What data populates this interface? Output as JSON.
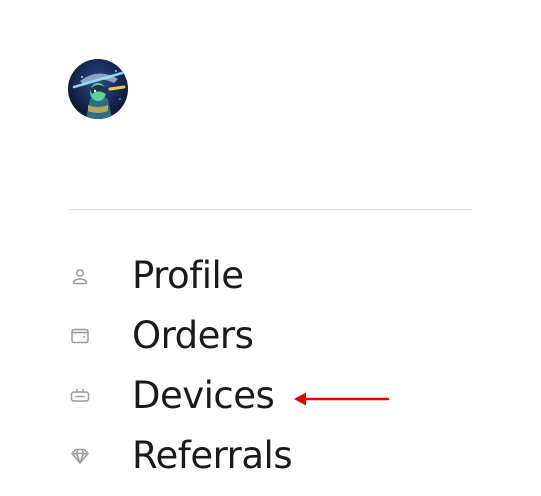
{
  "user": {
    "avatar_alt": "User avatar"
  },
  "nav": {
    "items": [
      {
        "label": "Profile",
        "icon": "person-icon"
      },
      {
        "label": "Orders",
        "icon": "wallet-icon"
      },
      {
        "label": "Devices",
        "icon": "device-icon"
      },
      {
        "label": "Referrals",
        "icon": "diamond-icon"
      }
    ]
  },
  "annotation": {
    "arrow_color": "#e60000",
    "points_to": "Devices"
  },
  "colors": {
    "text": "#1a1a1a",
    "icon": "#9a9a9a",
    "divider": "#e4e4e4"
  }
}
